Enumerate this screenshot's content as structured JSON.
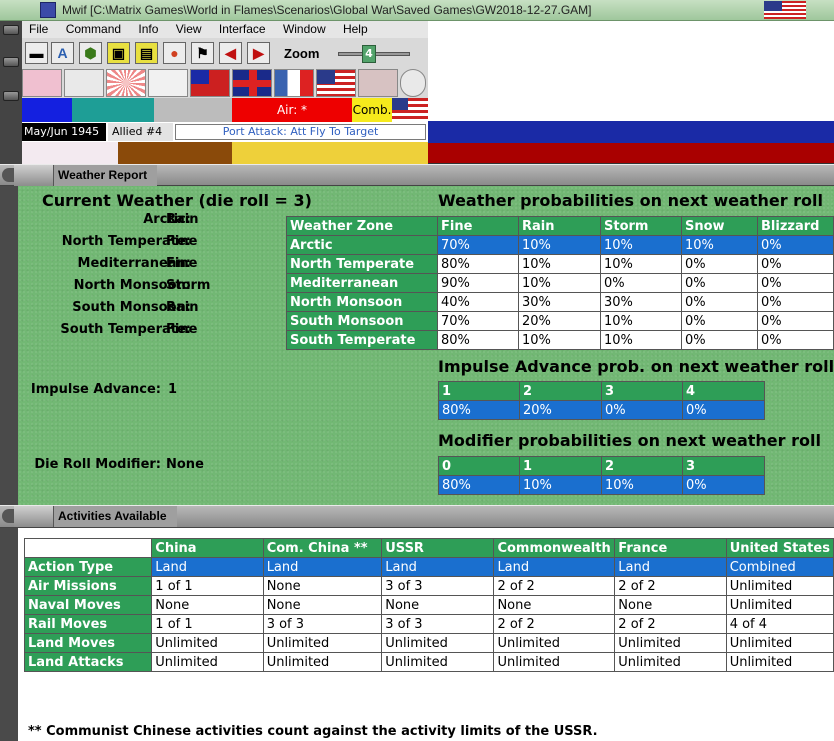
{
  "window": {
    "title": "Mwif [C:\\Matrix Games\\World in Flames\\Scenarios\\Global War\\Saved Games\\GW2018-12-27.GAM]"
  },
  "menu": [
    "File",
    "Command",
    "Info",
    "View",
    "Interface",
    "Window",
    "Help"
  ],
  "toolbar": {
    "zoom_label": "Zoom",
    "zoom_value": "4",
    "font_button": "A"
  },
  "status": {
    "date": "May/Jun 1945",
    "side": "Allied #4",
    "phase": "Port Attack: Att Fly To Target",
    "air_indicator": "Air: *",
    "comb_indicator": "Comb."
  },
  "weather_panel": {
    "header": "Weather Report",
    "current_title": "Current Weather (die roll = 3)",
    "zones": [
      {
        "label": "Arctic:",
        "value": "Rain"
      },
      {
        "label": "North Temperate:",
        "value": "Fine"
      },
      {
        "label": "Mediterranean:",
        "value": "Fine"
      },
      {
        "label": "North Monsoon:",
        "value": "Storm"
      },
      {
        "label": "South Monsoon:",
        "value": "Rain"
      },
      {
        "label": "South Temperate:",
        "value": "Fine"
      }
    ],
    "impulse_label": "Impulse Advance:",
    "impulse_value": "1",
    "modifier_label": "Die Roll Modifier:",
    "modifier_value": "None",
    "prob_title": "Weather probabilities on next weather roll",
    "prob_headers": [
      "Weather Zone",
      "Fine",
      "Rain",
      "Storm",
      "Snow",
      "Blizzard"
    ],
    "prob_rows": [
      [
        "Arctic",
        "70%",
        "10%",
        "10%",
        "10%",
        "0%"
      ],
      [
        "North Temperate",
        "80%",
        "10%",
        "10%",
        "0%",
        "0%"
      ],
      [
        "Mediterranean",
        "90%",
        "10%",
        "0%",
        "0%",
        "0%"
      ],
      [
        "North Monsoon",
        "40%",
        "30%",
        "30%",
        "0%",
        "0%"
      ],
      [
        "South Monsoon",
        "70%",
        "20%",
        "10%",
        "0%",
        "0%"
      ],
      [
        "South Temperate",
        "80%",
        "10%",
        "10%",
        "0%",
        "0%"
      ]
    ],
    "impulse_title": "Impulse Advance prob. on next weather roll",
    "impulse_headers": [
      "1",
      "2",
      "3",
      "4"
    ],
    "impulse_values": [
      "80%",
      "20%",
      "0%",
      "0%"
    ],
    "modifier_title": "Modifier probabilities on next weather roll",
    "modifier_headers": [
      "0",
      "1",
      "2",
      "3"
    ],
    "modifier_values": [
      "80%",
      "10%",
      "10%",
      "0%"
    ]
  },
  "activities_panel": {
    "header": "Activities Available",
    "columns": [
      "",
      "China",
      "Com. China **",
      "USSR",
      "Commonwealth",
      "France",
      "United States"
    ],
    "rows": [
      [
        "Action Type",
        "Land",
        "Land",
        "Land",
        "Land",
        "Land",
        "Combined"
      ],
      [
        "Air Missions",
        "1 of 1",
        "None",
        "3 of 3",
        "2 of 2",
        "2 of 2",
        "Unlimited"
      ],
      [
        "Naval Moves",
        "None",
        "None",
        "None",
        "None",
        "None",
        "Unlimited"
      ],
      [
        "Rail Moves",
        "1 of 1",
        "3 of 3",
        "3 of 3",
        "2 of 2",
        "2 of 2",
        "4 of 4"
      ],
      [
        "Land Moves",
        "Unlimited",
        "Unlimited",
        "Unlimited",
        "Unlimited",
        "Unlimited",
        "Unlimited"
      ],
      [
        "Land Attacks",
        "Unlimited",
        "Unlimited",
        "Unlimited",
        "Unlimited",
        "Unlimited",
        "Unlimited"
      ]
    ],
    "footnote": "** Communist Chinese activities count against the activity limits of the USSR."
  }
}
